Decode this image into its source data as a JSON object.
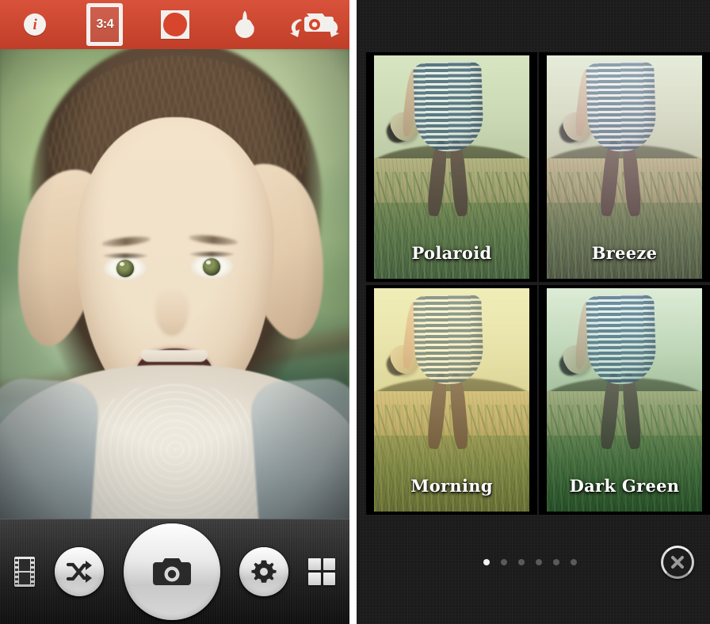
{
  "app": {
    "title": "Camera Filter App",
    "accent_color": "#d6452c",
    "panel_background": "#1b1b1b"
  },
  "camera": {
    "toolbar": {
      "items": [
        {
          "name": "info-icon",
          "label": "i",
          "selected": false
        },
        {
          "name": "aspect-ratio-button",
          "label": "3:4",
          "selected": true
        },
        {
          "name": "vignette-icon",
          "label": "Vignette",
          "selected": false
        },
        {
          "name": "blur-drop-icon",
          "label": "Blur",
          "selected": false
        },
        {
          "name": "flip-camera-icon",
          "label": "Flip Camera",
          "selected": false
        }
      ],
      "aspect_ratio_value": "3:4"
    },
    "controls": {
      "film_label": "Gallery",
      "shuffle_label": "Shuffle",
      "shutter_label": "Capture",
      "settings_label": "Settings",
      "grid_label": "Grid"
    }
  },
  "filters": {
    "items": [
      {
        "name": "Polaroid",
        "grade": "polaroid"
      },
      {
        "name": "Breeze",
        "grade": "breeze"
      },
      {
        "name": "Morning",
        "grade": "morning"
      },
      {
        "name": "Dark Green",
        "grade": "darkgreen"
      }
    ],
    "pager": {
      "total_pages": 6,
      "current_page": 1
    },
    "close_label": "Close"
  }
}
